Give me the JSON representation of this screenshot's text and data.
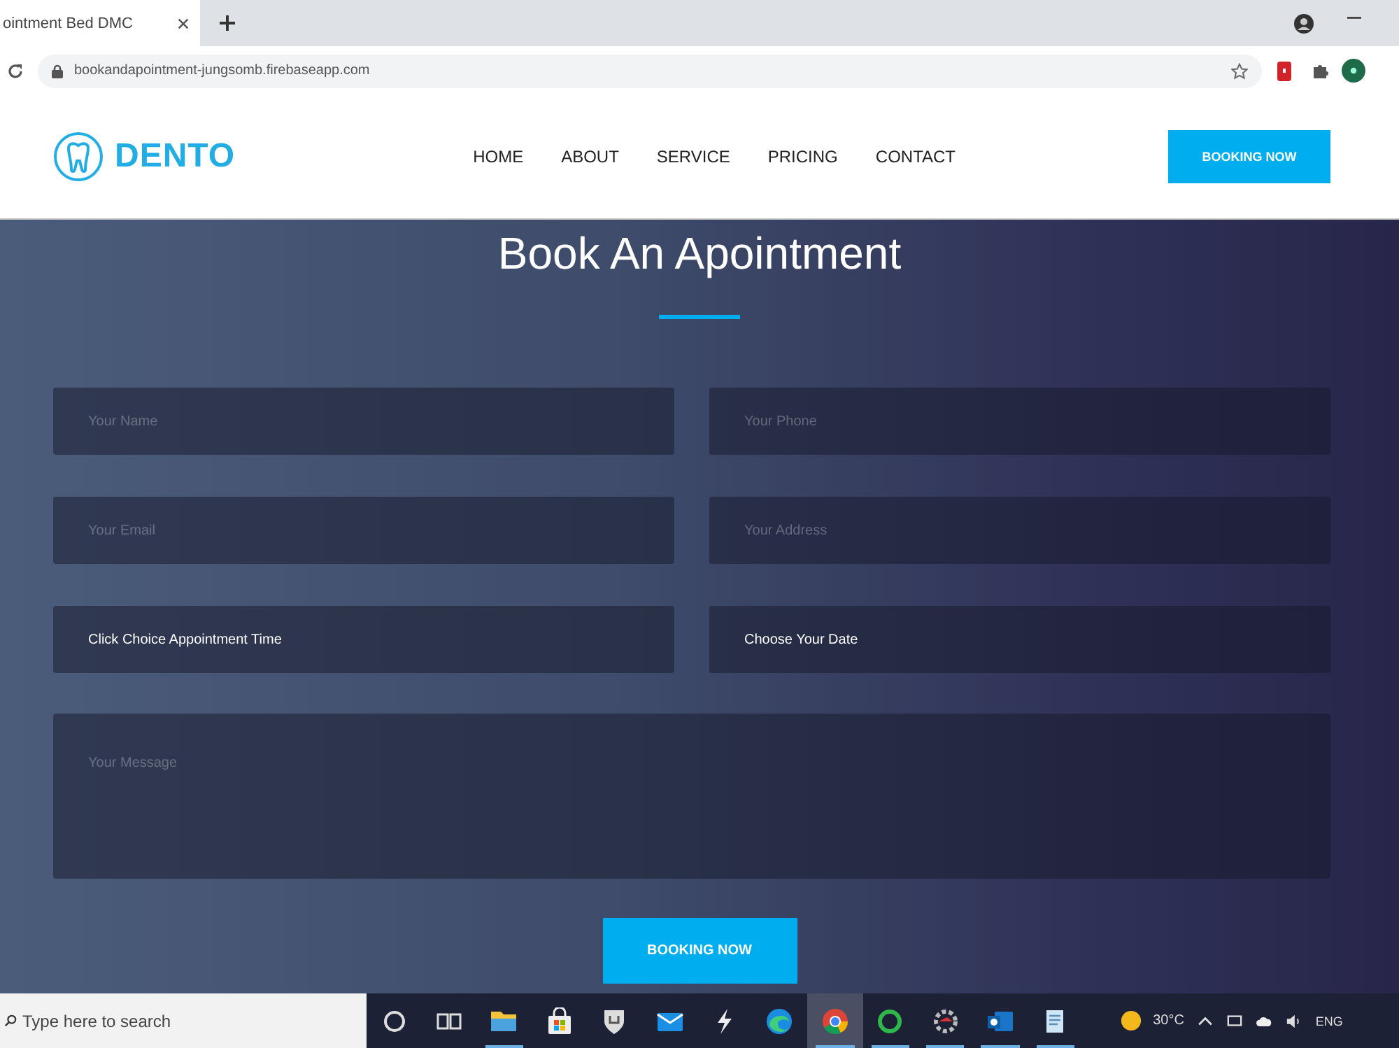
{
  "browser": {
    "tab": {
      "title": "ointment Bed DMC"
    },
    "address": "bookandapointment-jungsomb.firebaseapp.com"
  },
  "site": {
    "logo": "DENTO",
    "nav": [
      {
        "label": "HOME"
      },
      {
        "label": "ABOUT"
      },
      {
        "label": "SERVICE"
      },
      {
        "label": "PRICING"
      },
      {
        "label": "CONTACT"
      }
    ],
    "cta": "BOOKING NOW"
  },
  "form": {
    "title": "Book An Apointment",
    "fields": [
      {
        "kind": "text",
        "placeholder": "Your Name"
      },
      {
        "kind": "text",
        "placeholder": "Your Phone"
      },
      {
        "kind": "text",
        "placeholder": "Your Email"
      },
      {
        "kind": "text",
        "placeholder": "Your Address"
      },
      {
        "kind": "select",
        "value": "Click Choice Appointment Time"
      },
      {
        "kind": "date",
        "value": "Choose Your Date"
      },
      {
        "kind": "textarea",
        "placeholder": "Your Message"
      }
    ],
    "submit": "BOOKING NOW"
  },
  "taskbar": {
    "search": {
      "placeholder": "Type here to search"
    },
    "apps": [
      {
        "running": false,
        "selected": false
      },
      {
        "running": false,
        "selected": false
      },
      {
        "running": true,
        "selected": false
      },
      {
        "running": false,
        "selected": false
      },
      {
        "running": false,
        "selected": false
      },
      {
        "running": false,
        "selected": false
      },
      {
        "running": false,
        "selected": false
      },
      {
        "running": false,
        "selected": false
      },
      {
        "running": true,
        "selected": true
      },
      {
        "running": true,
        "selected": false
      },
      {
        "running": true,
        "selected": false
      },
      {
        "running": true,
        "selected": false
      },
      {
        "running": true,
        "selected": false
      }
    ],
    "weather": "30°C",
    "language": "ENG"
  }
}
